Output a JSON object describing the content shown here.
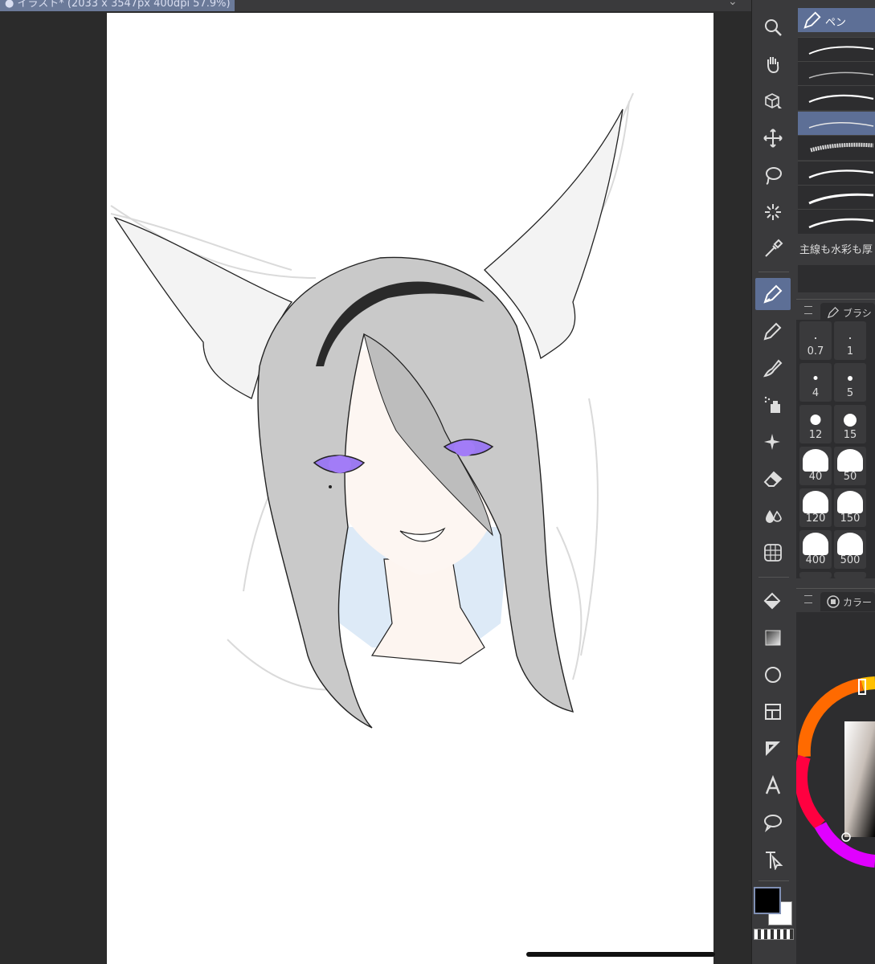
{
  "document_tab": {
    "title": "● イラスト* (2033 x 3547px 400dpi 57.9%)"
  },
  "tools": [
    {
      "name": "zoom-tool",
      "icon": "magnifier-icon"
    },
    {
      "name": "hand-tool",
      "icon": "hand-icon"
    },
    {
      "name": "object-tool",
      "icon": "cube-arrow-icon"
    },
    {
      "name": "move-tool",
      "icon": "move-cross-icon"
    },
    {
      "name": "lasso-tool",
      "icon": "lasso-icon"
    },
    {
      "name": "magic-wand-tool",
      "icon": "magic-wand-icon"
    },
    {
      "name": "eyedropper-tool",
      "icon": "eyedropper-icon"
    },
    {
      "name": "pen-tool",
      "icon": "pen-nib-icon",
      "active": true
    },
    {
      "name": "pencil-tool",
      "icon": "pencil-icon"
    },
    {
      "name": "brush-tool",
      "icon": "brush-icon"
    },
    {
      "name": "airbrush-tool",
      "icon": "airbrush-icon"
    },
    {
      "name": "decoration-tool",
      "icon": "sparkle-icon"
    },
    {
      "name": "eraser-tool",
      "icon": "eraser-icon"
    },
    {
      "name": "blend-tool",
      "icon": "droplets-icon"
    },
    {
      "name": "figure-tool",
      "icon": "grid-sphere-icon"
    },
    {
      "name": "fill-tool",
      "icon": "paint-bucket-icon"
    },
    {
      "name": "gradient-tool",
      "icon": "gradient-icon"
    },
    {
      "name": "shape-tool",
      "icon": "circle-icon"
    },
    {
      "name": "frame-tool",
      "icon": "panel-frame-icon"
    },
    {
      "name": "ruler-tool",
      "icon": "ruler-triangle-icon"
    },
    {
      "name": "text-tool",
      "icon": "text-a-icon"
    },
    {
      "name": "balloon-tool",
      "icon": "speech-balloon-icon"
    },
    {
      "name": "correct-line-tool",
      "icon": "correct-line-icon"
    }
  ],
  "brush_panel": {
    "header_label": "ペン",
    "note": "主線も水彩も厚"
  },
  "brush_size_panel": {
    "tab_label": "ブラシ",
    "sizes": [
      "0.7",
      "1",
      "4",
      "5",
      "12",
      "15",
      "40",
      "50",
      "120",
      "150",
      "400",
      "500"
    ]
  },
  "color_panel": {
    "tab_label": "カラー"
  },
  "colors": {
    "main": "#000000",
    "sub": "#ffffff",
    "accent": "#5d6f96"
  }
}
